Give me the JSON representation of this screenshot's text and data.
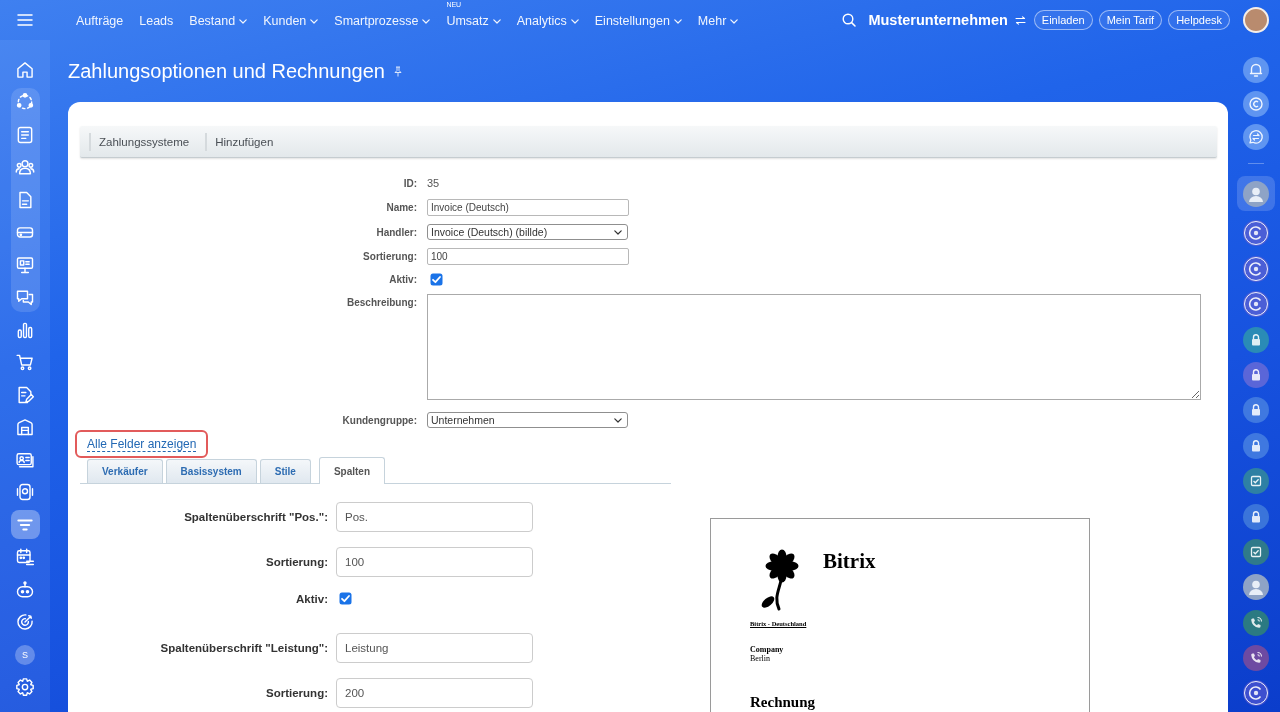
{
  "top_bar": {
    "nav": [
      {
        "label": "Aufträge",
        "has_menu": false
      },
      {
        "label": "Leads",
        "has_menu": false
      },
      {
        "label": "Bestand",
        "has_menu": true
      },
      {
        "label": "Kunden",
        "has_menu": true
      },
      {
        "label": "Smartprozesse",
        "has_menu": true
      },
      {
        "label": "Umsatz",
        "has_menu": true,
        "badge": "NEU"
      },
      {
        "label": "Analytics",
        "has_menu": true
      },
      {
        "label": "Einstellungen",
        "has_menu": true
      },
      {
        "label": "Mehr",
        "has_menu": true
      }
    ],
    "company": "Musterunternehmen",
    "buttons": [
      "Einladen",
      "Mein Tarif",
      "Helpdesk"
    ]
  },
  "left_sidebar": {
    "sections": [
      {
        "grouped": false,
        "items": [
          {
            "kind": "home",
            "selected": false
          }
        ]
      },
      {
        "grouped": true,
        "items": [
          {
            "kind": "cycle",
            "selected": false
          },
          {
            "kind": "newspaper",
            "selected": false
          },
          {
            "kind": "users",
            "selected": false
          },
          {
            "kind": "document",
            "selected": false
          },
          {
            "kind": "tray",
            "selected": false
          },
          {
            "kind": "presentation",
            "selected": false
          },
          {
            "kind": "chat",
            "selected": false
          }
        ]
      },
      {
        "grouped": false,
        "items": [
          {
            "kind": "chart",
            "selected": false
          },
          {
            "kind": "cart",
            "selected": false
          },
          {
            "kind": "edit",
            "selected": false
          },
          {
            "kind": "garage",
            "selected": false
          },
          {
            "kind": "contact",
            "selected": false
          },
          {
            "kind": "device",
            "selected": false
          },
          {
            "kind": "funnel",
            "selected": true
          },
          {
            "kind": "calendar",
            "selected": false
          },
          {
            "kind": "robot",
            "selected": false
          },
          {
            "kind": "target",
            "selected": false
          },
          {
            "kind": "user",
            "initial": "S",
            "selected": false
          },
          {
            "kind": "settings",
            "selected": false
          }
        ]
      }
    ]
  },
  "right_sidebar": {
    "top_items": [
      {
        "kind": "bell",
        "selected": false
      },
      {
        "kind": "coin",
        "selected": false
      },
      {
        "kind": "swap",
        "selected": false
      }
    ],
    "items": [
      {
        "kind": "avatar",
        "selected": true
      },
      {
        "kind": "channel",
        "color": "#4b5ed6",
        "selected": false
      },
      {
        "kind": "channel",
        "color": "#4b5ed6",
        "selected": false
      },
      {
        "kind": "channel",
        "color": "#4b5ed6",
        "selected": false
      },
      {
        "kind": "lock",
        "color": "#2a8bb6",
        "selected": false
      },
      {
        "kind": "lock",
        "color": "#5a66d8",
        "selected": false
      },
      {
        "kind": "lock",
        "color": "#3f78e0",
        "selected": false
      },
      {
        "kind": "lock",
        "color": "#3f78e0",
        "selected": false
      },
      {
        "kind": "task",
        "color": "#2e80a4",
        "selected": false
      },
      {
        "kind": "lock",
        "color": "#3a74da",
        "selected": false
      },
      {
        "kind": "task",
        "color": "#2f7a8a",
        "selected": false
      },
      {
        "kind": "avatar",
        "selected": false
      },
      {
        "kind": "phone",
        "color": "#2b7a82",
        "selected": false
      },
      {
        "kind": "phone",
        "color": "#6d4aa2",
        "selected": false
      },
      {
        "kind": "channel",
        "color": "#3d4fcf",
        "selected": false
      }
    ]
  },
  "page": {
    "title": "Zahlungsoptionen und Rechnungen"
  },
  "toolbar": [
    "Zahlungssysteme",
    "Hinzufügen"
  ],
  "form": {
    "fields": [
      {
        "kind": "text",
        "label": "ID:",
        "value": "35"
      },
      {
        "kind": "input",
        "label": "Name:",
        "value": "Invoice (Deutsch)"
      },
      {
        "kind": "select",
        "label": "Handler:",
        "value": "Invoice (Deutsch) (billde)"
      },
      {
        "kind": "input",
        "label": "Sortierung:",
        "value": "100"
      },
      {
        "kind": "checkbox",
        "label": "Aktiv:",
        "checked": true
      },
      {
        "kind": "textarea",
        "label": "Beschreibung:"
      },
      {
        "kind": "select",
        "label": "Kundengruppe:",
        "value": "Unternehmen"
      }
    ]
  },
  "show_all_link": {
    "label": "Alle Felder anzeigen",
    "highlighted": true
  },
  "tabs": [
    {
      "label": "Verkäufer",
      "selected": false
    },
    {
      "label": "Basissystem",
      "selected": false
    },
    {
      "label": "Stile",
      "selected": false
    },
    {
      "label": "Spalten",
      "selected": true
    }
  ],
  "column_settings": {
    "groups": [
      [
        {
          "kind": "input",
          "label": "Spaltenüberschrift \"Pos.\":",
          "value": "Pos."
        },
        {
          "kind": "input",
          "label": "Sortierung:",
          "value": "100"
        },
        {
          "kind": "checkbox",
          "label": "Aktiv:",
          "checked": true
        }
      ],
      [
        {
          "kind": "input",
          "label": "Spaltenüberschrift \"Leistung\":",
          "value": "Leistung"
        },
        {
          "kind": "input",
          "label": "Sortierung:",
          "value": "200"
        }
      ]
    ]
  },
  "invoice_preview": {
    "company_name": "Bitrix",
    "sender_line": "Bitrix - Deutschland",
    "recipient": "Company",
    "city": "Berlin",
    "heading": "Rechnung"
  }
}
